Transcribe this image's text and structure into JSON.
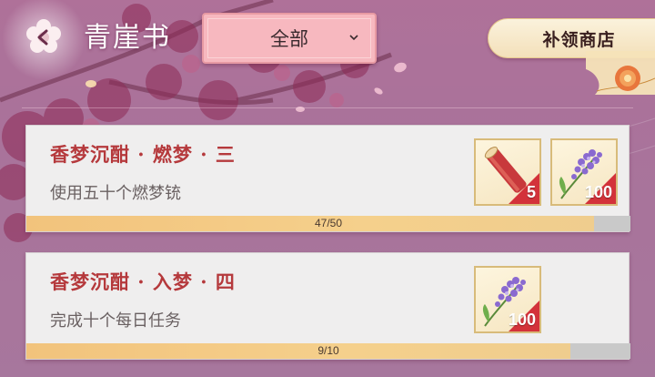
{
  "header": {
    "title": "青崖书",
    "back_icon": "back-arrow-icon",
    "filter": {
      "selected": "全部",
      "icon": "chevron-down-icon"
    },
    "shop_label": "补领商店"
  },
  "tasks": [
    {
      "title": "香梦沉酣 · 燃梦 · 三",
      "description": "使用五十个燃梦铳",
      "progress_text": "47/50",
      "progress": 0.94,
      "rewards": [
        {
          "icon": "red-scroll-icon",
          "count": "5"
        },
        {
          "icon": "lavender-flower-icon",
          "count": "100"
        }
      ]
    },
    {
      "title": "香梦沉酣 · 入梦 · 四",
      "description": "完成十个每日任务",
      "progress_text": "9/10",
      "progress": 0.9,
      "rewards": [
        {
          "icon": "lavender-flower-icon",
          "count": "100"
        }
      ]
    }
  ],
  "colors": {
    "background": "#a8739c",
    "title_red": "#b5393c",
    "filter_pink": "#f7b8bf",
    "reward_badge": "#d3323a",
    "progress_fill": "#f2c37c"
  }
}
